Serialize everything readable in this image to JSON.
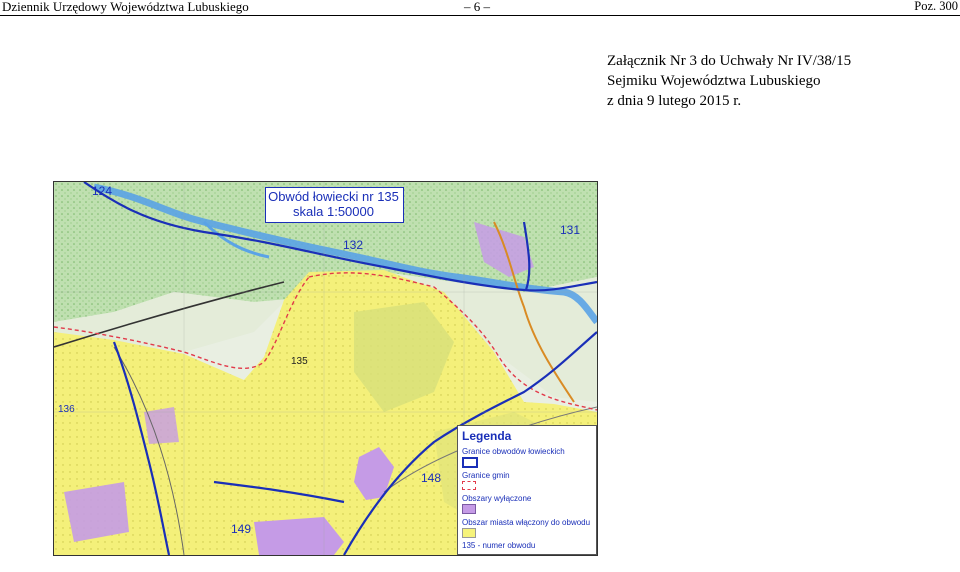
{
  "header": {
    "journal": "Dziennik Urzędowy Województwa Lubuskiego",
    "page": "– 6 –",
    "position": "Poz. 300"
  },
  "attachment": {
    "line1": "Załącznik Nr 3 do Uchwały Nr IV/38/15",
    "line2": "Sejmiku Województwa Lubuskiego",
    "line3": "z dnia 9 lutego 2015 r."
  },
  "map": {
    "title_line1": "Obwód łowiecki nr 135",
    "title_line2": "skala 1:50000",
    "district_numbers": [
      "124",
      "132",
      "131",
      "135",
      "136",
      "148",
      "149"
    ],
    "legend": {
      "heading": "Legenda",
      "items": [
        {
          "label": "Granice obwodów łowieckich",
          "color": "#1a2fb8"
        },
        {
          "label": "Granice gmin",
          "color": "#e23a4a"
        },
        {
          "label": "Obszary wyłączone",
          "color": "#c59be6"
        },
        {
          "label": "Obszar miasta włączony do obwodu",
          "color": "#f6f37a"
        },
        {
          "label": "135 - numer obwodu",
          "color": ""
        }
      ]
    }
  }
}
